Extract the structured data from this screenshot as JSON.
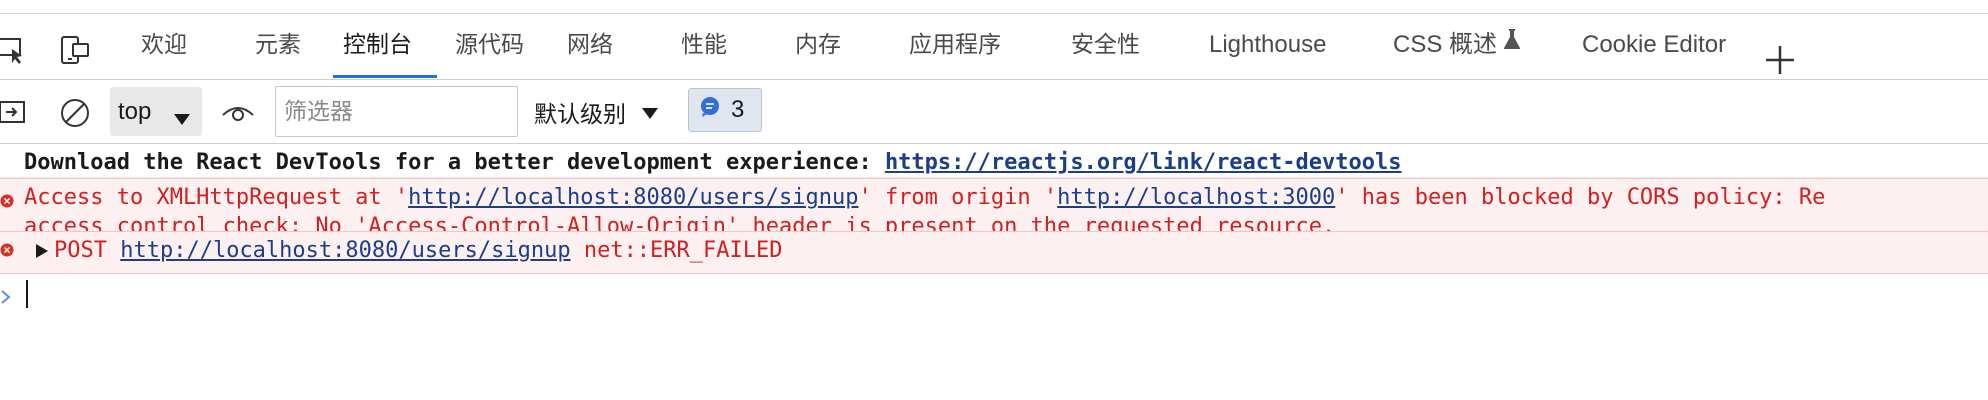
{
  "tabs": [
    {
      "label": "欢迎"
    },
    {
      "label": "元素"
    },
    {
      "label": "控制台"
    },
    {
      "label": "源代码"
    },
    {
      "label": "网络"
    },
    {
      "label": "性能"
    },
    {
      "label": "内存"
    },
    {
      "label": "应用程序"
    },
    {
      "label": "安全性"
    },
    {
      "label": "Lighthouse"
    },
    {
      "label": "CSS 概述"
    },
    {
      "label": "Cookie Editor"
    }
  ],
  "active_tab": "控制台",
  "toolbar": {
    "context": "top",
    "filter_placeholder": "筛选器",
    "filter_value": "",
    "level": "默认级别",
    "message_count": "3"
  },
  "messages": {
    "info": {
      "text": "Download the React DevTools for a better development experience: ",
      "link": "https://reactjs.org/link/react-devtools"
    },
    "cors": {
      "prefix": "Access to XMLHttpRequest at '",
      "url1": "http://localhost:8080/users/signup",
      "middle": "' from origin '",
      "url2": "http://localhost:3000",
      "suffix": "' has been blocked by CORS policy: Re",
      "line2": "access control check: No 'Access-Control-Allow-Origin' header is present on the requested resource."
    },
    "post": {
      "method": "POST",
      "url": "http://localhost:8080/users/signup",
      "error": "net::ERR_FAILED"
    }
  },
  "colors": {
    "accent": "#1a73e8",
    "error_text": "#d21f1f",
    "error_bg": "#fdf0f0",
    "link": "#1a3e8a"
  }
}
